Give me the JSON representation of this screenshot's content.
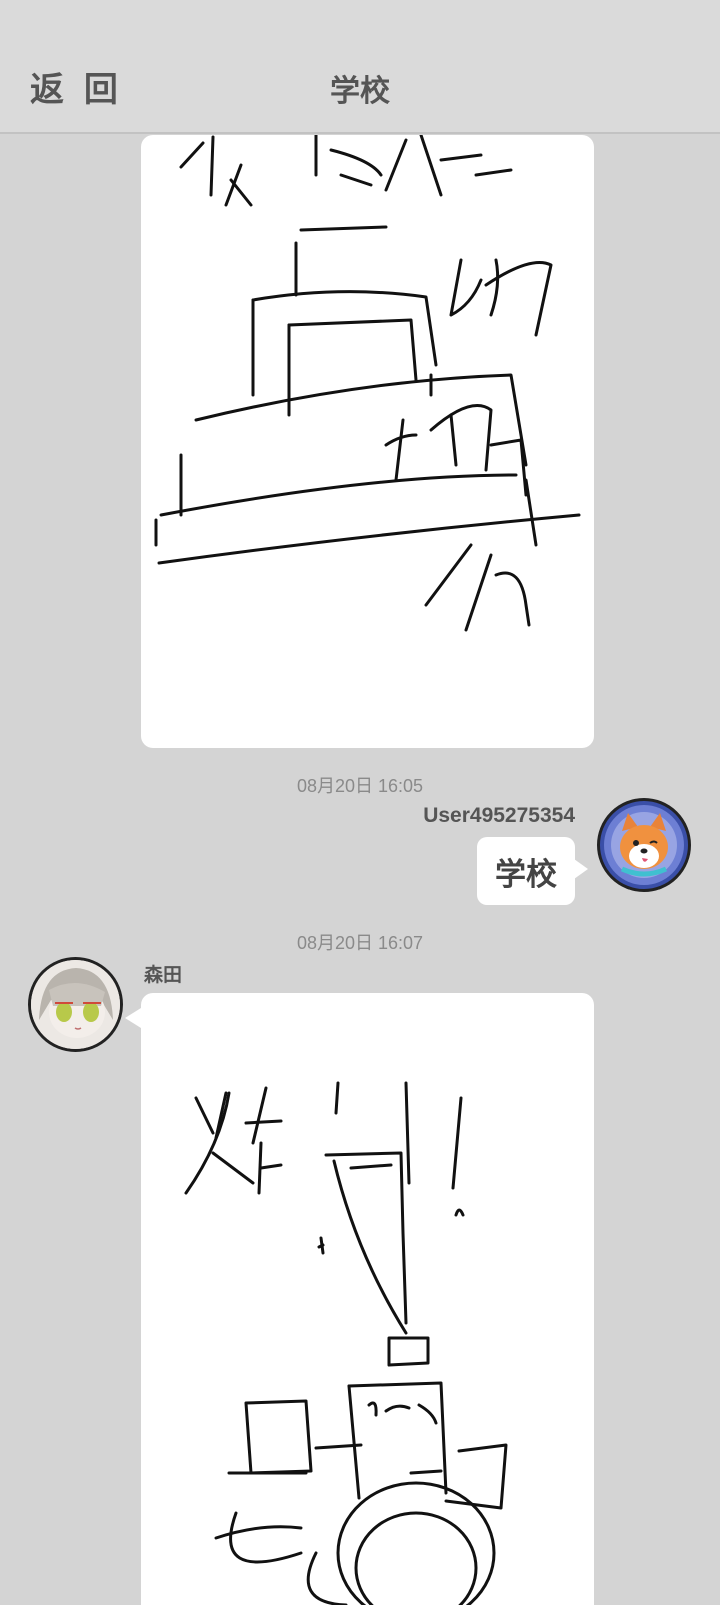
{
  "header": {
    "back_label": "返 回",
    "title": "学校"
  },
  "messages": [
    {
      "timestamp": "08月20日  16:05",
      "username": "User495275354",
      "text": "学校"
    },
    {
      "timestamp": "08月20日  16:07",
      "username": "森田"
    }
  ],
  "colors": {
    "background": "#d4d4d4",
    "header_background": "#dadada",
    "bubble": "#ffffff"
  }
}
